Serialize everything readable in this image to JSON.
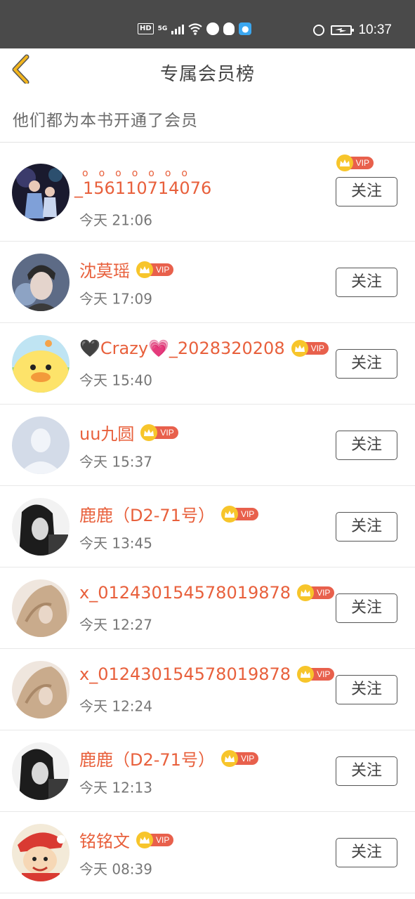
{
  "status_bar": {
    "hd_badge": "HD",
    "network": "5G",
    "time": "10:37",
    "icons": [
      "hd-icon",
      "signal-icon",
      "wifi-icon",
      "browser-icon",
      "qq-icon",
      "lightbulb-icon",
      "alarm-icon",
      "battery-charging-icon"
    ]
  },
  "header": {
    "title": "专属会员榜",
    "back_icon": "chevron-left-icon"
  },
  "subtitle": "他们都为本书开通了会员",
  "vip_label": "VIP",
  "follow_label": "关注",
  "colors": {
    "name": "#e8603c",
    "vip_badge": "#e8604c",
    "crown": "#f7c52b",
    "back_chevron": "#f2b51d"
  },
  "members": [
    {
      "name": "_156110714076",
      "time": "今天 21:06",
      "avatar": "avatar-two-girls"
    },
    {
      "name": "沈莫瑶",
      "time": "今天 17:09",
      "avatar": "avatar-young-man"
    },
    {
      "name": "🖤Crazy💗_2028320208",
      "time": "今天 15:40",
      "avatar": "avatar-yellow-duck"
    },
    {
      "name": "uu九圆",
      "time": "今天 15:37",
      "avatar": "avatar-default"
    },
    {
      "name": "鹿鹿（D2-71号）",
      "time": "今天 13:45",
      "avatar": "avatar-bw-girl"
    },
    {
      "name": "x_012430154578019878",
      "time": "今天 12:27",
      "avatar": "avatar-blond-hair"
    },
    {
      "name": "x_012430154578019878",
      "time": "今天 12:24",
      "avatar": "avatar-blond-hair"
    },
    {
      "name": "鹿鹿（D2-71号）",
      "time": "今天 12:13",
      "avatar": "avatar-bw-girl"
    },
    {
      "name": "铭铭文",
      "time": "今天 08:39",
      "avatar": "avatar-cartoon-boy"
    }
  ]
}
